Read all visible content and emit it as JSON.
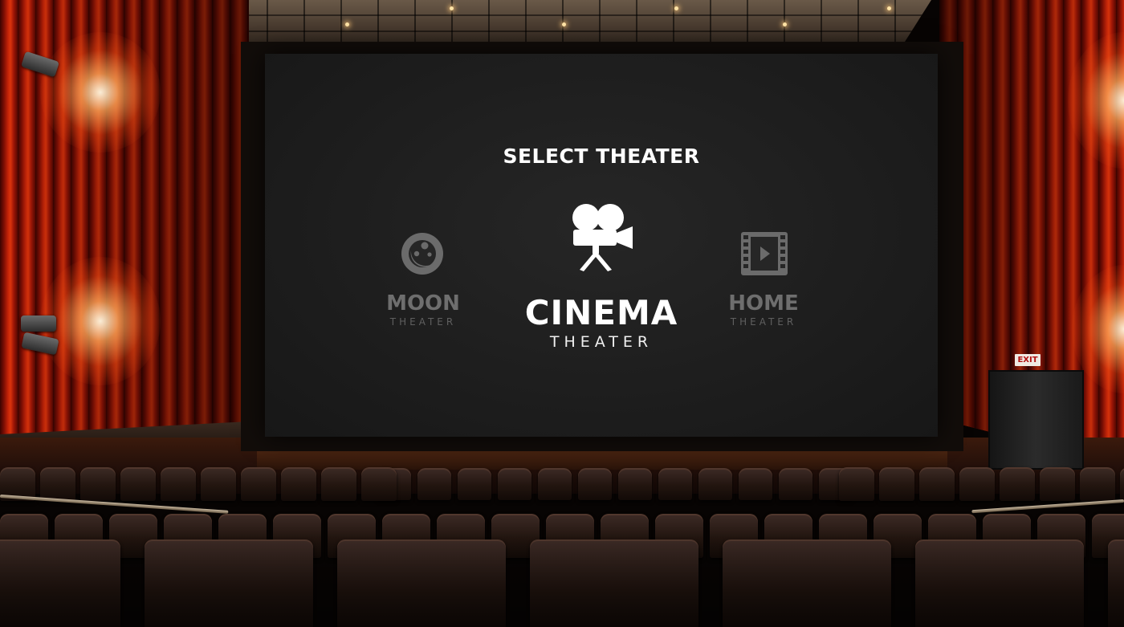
{
  "screen": {
    "title": "SELECT THEATER"
  },
  "options": [
    {
      "name": "MOON",
      "subtitle": "THEATER",
      "icon": "moon-icon",
      "state": "inactive"
    },
    {
      "name": "CINEMA",
      "subtitle": "THEATER",
      "icon": "movie-camera-icon",
      "state": "selected"
    },
    {
      "name": "HOME",
      "subtitle": "THEATER",
      "icon": "film-strip-icon",
      "state": "inactive"
    }
  ],
  "exit_sign": "EXIT",
  "colors": {
    "curtain": "#c62408",
    "screen": "#1d1d1d",
    "selected_text": "#ffffff",
    "inactive_text": "#6e6e6e"
  }
}
